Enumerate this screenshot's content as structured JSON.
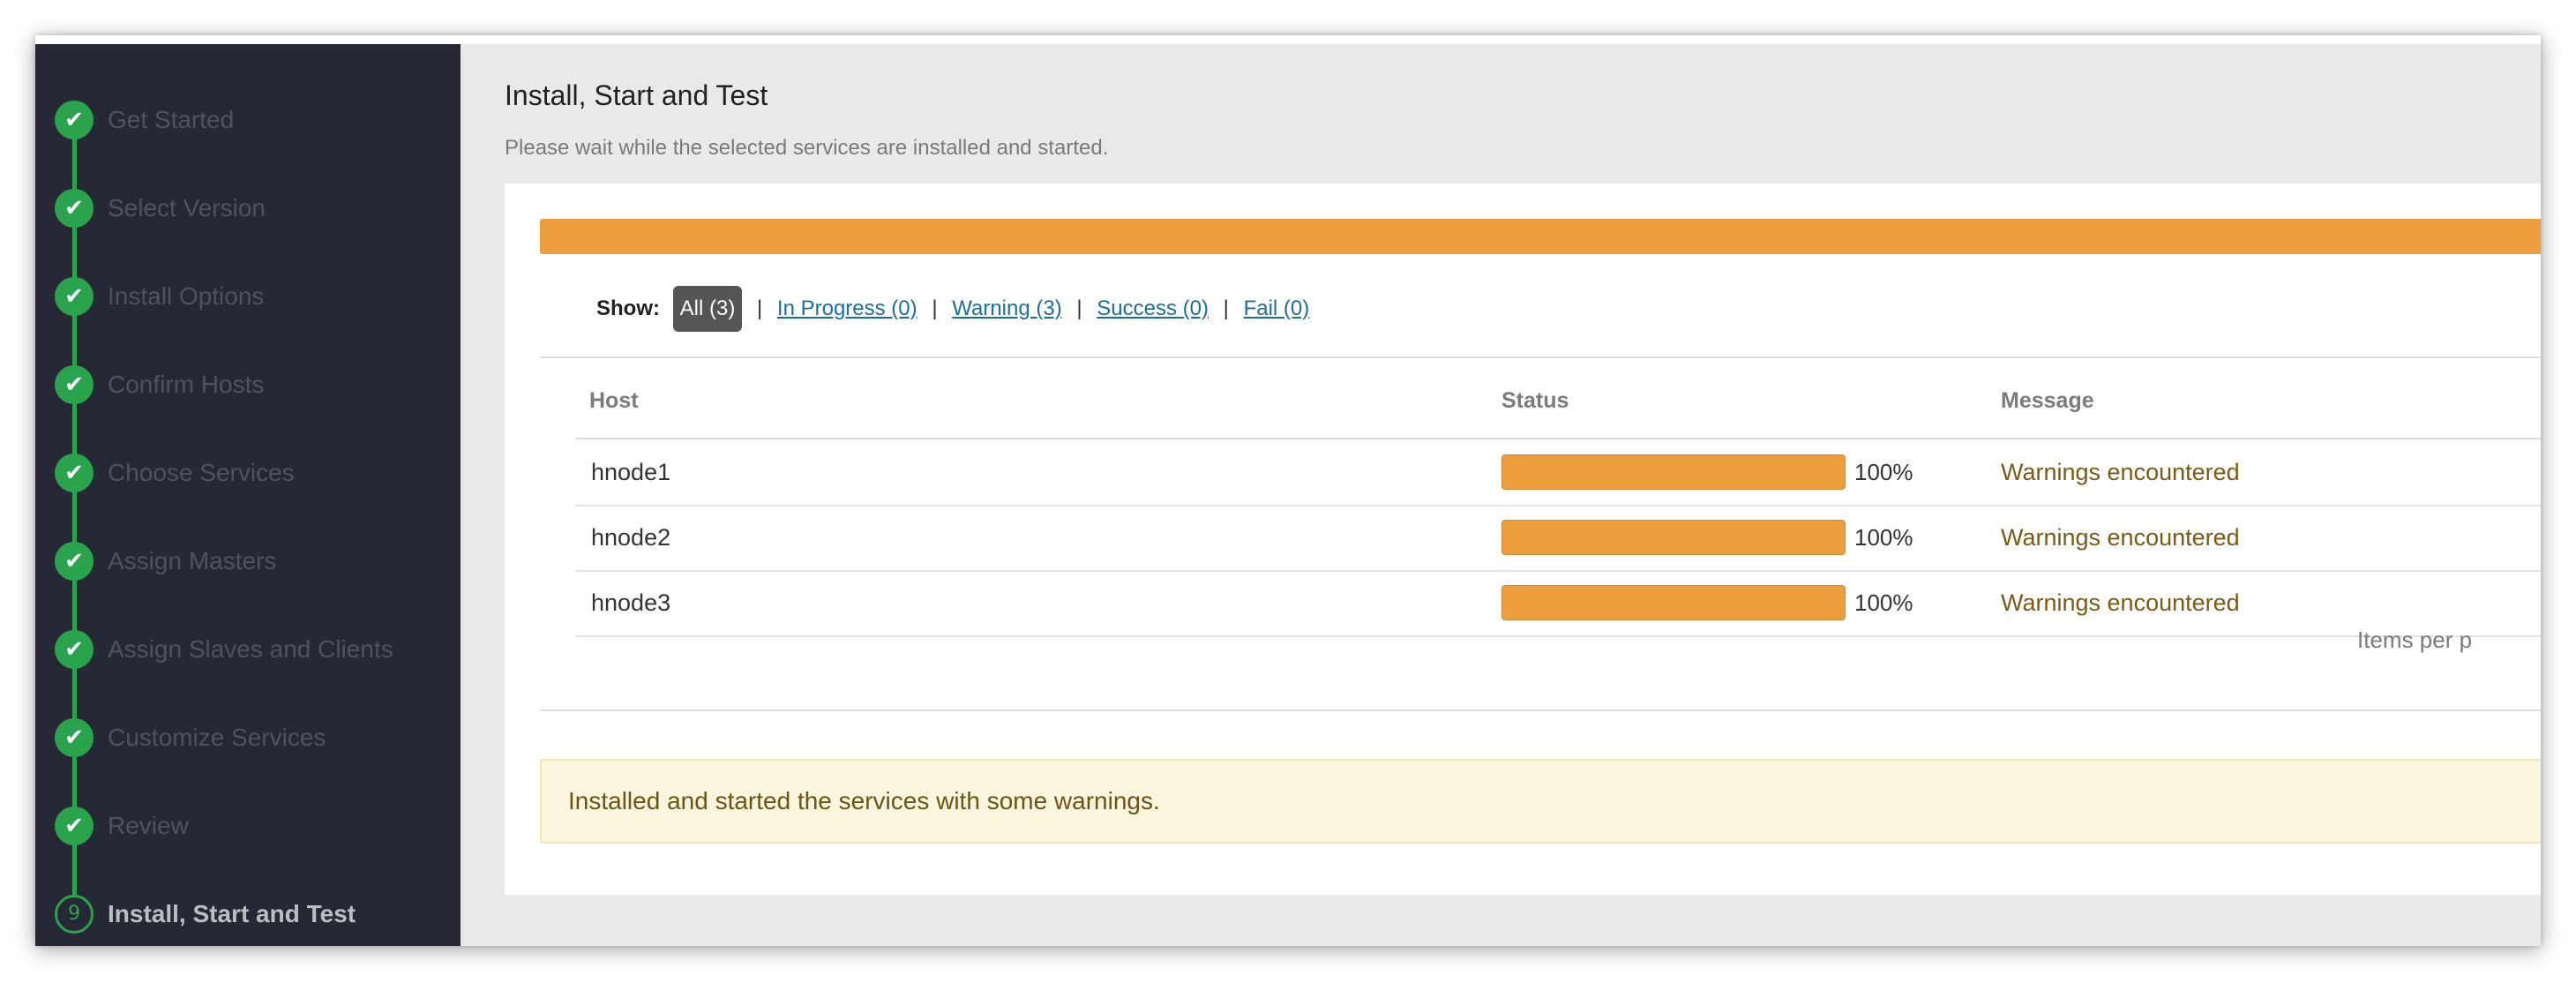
{
  "sidebar": {
    "steps": [
      {
        "label": "Get Started",
        "marker": "✔",
        "status": "done"
      },
      {
        "label": "Select Version",
        "marker": "✔",
        "status": "done"
      },
      {
        "label": "Install Options",
        "marker": "✔",
        "status": "done"
      },
      {
        "label": "Confirm Hosts",
        "marker": "✔",
        "status": "done"
      },
      {
        "label": "Choose Services",
        "marker": "✔",
        "status": "done"
      },
      {
        "label": "Assign Masters",
        "marker": "✔",
        "status": "done"
      },
      {
        "label": "Assign Slaves and Clients",
        "marker": "✔",
        "status": "done"
      },
      {
        "label": "Customize Services",
        "marker": "✔",
        "status": "done"
      },
      {
        "label": "Review",
        "marker": "✔",
        "status": "done"
      },
      {
        "label": "Install, Start and Test",
        "marker": "9",
        "status": "current"
      }
    ]
  },
  "main": {
    "title": "Install, Start and Test",
    "subtitle": "Please wait while the selected services are installed and started.",
    "overall_progress": 1.0,
    "filters": {
      "show_label": "Show:",
      "all": "All (3)",
      "in_progress": "In Progress (0)",
      "warning": "Warning (3)",
      "success": "Success (0)",
      "fail": "Fail (0)",
      "separator": "|"
    },
    "table": {
      "headers": {
        "host": "Host",
        "status": "Status",
        "message": "Message"
      },
      "rows": [
        {
          "host": "hnode1",
          "progress": 1.0,
          "percent": "100%",
          "message": "Warnings encountered"
        },
        {
          "host": "hnode2",
          "progress": 1.0,
          "percent": "100%",
          "message": "Warnings encountered"
        },
        {
          "host": "hnode3",
          "progress": 1.0,
          "percent": "100%",
          "message": "Warnings encountered"
        }
      ],
      "items_per_page": "Items per p"
    },
    "alert": "Installed and started the services with some warnings."
  },
  "colors": {
    "sidebar_bg": "#262835",
    "step_done": "#2aa34d",
    "progress_warning": "#ec9e3c",
    "link": "#1a6ea5",
    "alert_bg": "#fbf5de"
  }
}
